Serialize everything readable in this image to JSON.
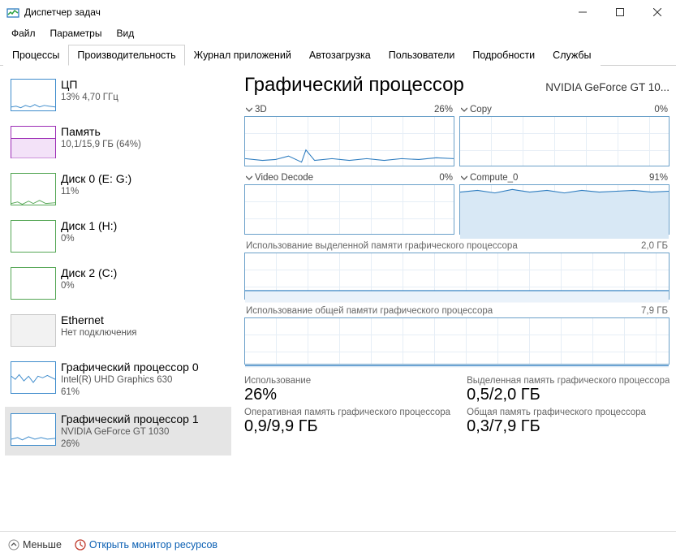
{
  "window": {
    "title": "Диспетчер задач"
  },
  "menu": {
    "file": "Файл",
    "options": "Параметры",
    "view": "Вид"
  },
  "tabs": {
    "processes": "Процессы",
    "performance": "Производительность",
    "app_history": "Журнал приложений",
    "startup": "Автозагрузка",
    "users": "Пользователи",
    "details": "Подробности",
    "services": "Службы"
  },
  "sidebar": {
    "items": [
      {
        "title": "ЦП",
        "sub1": "13% 4,70 ГГц",
        "sub2": "",
        "thumb_color": "#3f8ccc"
      },
      {
        "title": "Память",
        "sub1": "10,1/15,9 ГБ (64%)",
        "sub2": "",
        "thumb_color": "#9c2db5"
      },
      {
        "title": "Диск 0 (E: G:)",
        "sub1": "11%",
        "sub2": "",
        "thumb_color": "#54a654"
      },
      {
        "title": "Диск 1 (H:)",
        "sub1": "0%",
        "sub2": "",
        "thumb_color": "#54a654"
      },
      {
        "title": "Диск 2 (C:)",
        "sub1": "0%",
        "sub2": "",
        "thumb_color": "#54a654"
      },
      {
        "title": "Ethernet",
        "sub1": "Нет подключения",
        "sub2": "",
        "thumb_color": "#c2c2c2"
      },
      {
        "title": "Графический процессор 0",
        "sub1": "Intel(R) UHD Graphics 630",
        "sub2": "61%",
        "thumb_color": "#3f8ccc"
      },
      {
        "title": "Графический процессор 1",
        "sub1": "NVIDIA GeForce GT 1030",
        "sub2": "26%",
        "thumb_color": "#3f8ccc"
      }
    ]
  },
  "gpu": {
    "heading": "Графический процессор",
    "name": "NVIDIA GeForce GT 10...",
    "engines": [
      {
        "name": "3D",
        "pct": "26%"
      },
      {
        "name": "Copy",
        "pct": "0%"
      },
      {
        "name": "Video Decode",
        "pct": "0%"
      },
      {
        "name": "Compute_0",
        "pct": "91%"
      }
    ],
    "dedicated_mem_label": "Использование выделенной памяти графического процессора",
    "dedicated_mem_max": "2,0 ГБ",
    "shared_mem_label": "Использование общей памяти графического процессора",
    "shared_mem_max": "7,9 ГБ",
    "stats": {
      "utilization_label": "Использование",
      "utilization_value": "26%",
      "dedicated_label": "Выделенная память графического процессора",
      "dedicated_value": "0,5/2,0 ГБ",
      "gpu_ram_label": "Оперативная память графического процессора",
      "gpu_ram_value": "0,9/9,9 ГБ",
      "shared_label": "Общая память графического процессора",
      "shared_value": "0,3/7,9 ГБ"
    }
  },
  "footer": {
    "fewer": "Меньше",
    "resmon": "Открыть монитор ресурсов"
  },
  "chart_data": [
    {
      "type": "line",
      "title": "3D",
      "ylim": [
        0,
        100
      ],
      "values": [
        28,
        24,
        22,
        30,
        20,
        18,
        22,
        36,
        22,
        24,
        20,
        22,
        26,
        24,
        22,
        20,
        24,
        22,
        24,
        26
      ],
      "xlabel": "",
      "ylabel": ""
    },
    {
      "type": "line",
      "title": "Copy",
      "ylim": [
        0,
        100
      ],
      "values": [
        0,
        0,
        0,
        0,
        0,
        0,
        0,
        0,
        0,
        0,
        0,
        0,
        0,
        0,
        0,
        0,
        0,
        0,
        0,
        0
      ],
      "xlabel": "",
      "ylabel": ""
    },
    {
      "type": "line",
      "title": "Video Decode",
      "ylim": [
        0,
        100
      ],
      "values": [
        0,
        0,
        0,
        0,
        0,
        0,
        0,
        0,
        0,
        0,
        0,
        0,
        0,
        0,
        0,
        0,
        0,
        0,
        0,
        0
      ],
      "xlabel": "",
      "ylabel": ""
    },
    {
      "type": "line",
      "title": "Compute_0",
      "ylim": [
        0,
        100
      ],
      "values": [
        90,
        92,
        88,
        91,
        93,
        89,
        90,
        92,
        91,
        88,
        90,
        93,
        89,
        91,
        92,
        90,
        88,
        91,
        93,
        91
      ],
      "xlabel": "",
      "ylabel": ""
    },
    {
      "type": "line",
      "title": "Использование выделенной памяти",
      "ylim": [
        0,
        2.0
      ],
      "values": [
        0.5,
        0.5,
        0.5,
        0.5,
        0.5,
        0.5,
        0.5,
        0.5,
        0.5,
        0.5,
        0.5,
        0.5,
        0.5,
        0.5,
        0.5,
        0.5,
        0.5,
        0.5,
        0.5,
        0.5
      ],
      "xlabel": "",
      "ylabel": "ГБ"
    },
    {
      "type": "line",
      "title": "Использование общей памяти",
      "ylim": [
        0,
        7.9
      ],
      "values": [
        0.3,
        0.3,
        0.3,
        0.3,
        0.3,
        0.3,
        0.3,
        0.3,
        0.3,
        0.3,
        0.3,
        0.3,
        0.3,
        0.3,
        0.3,
        0.3,
        0.3,
        0.3,
        0.3,
        0.3
      ],
      "xlabel": "",
      "ylabel": "ГБ"
    }
  ]
}
